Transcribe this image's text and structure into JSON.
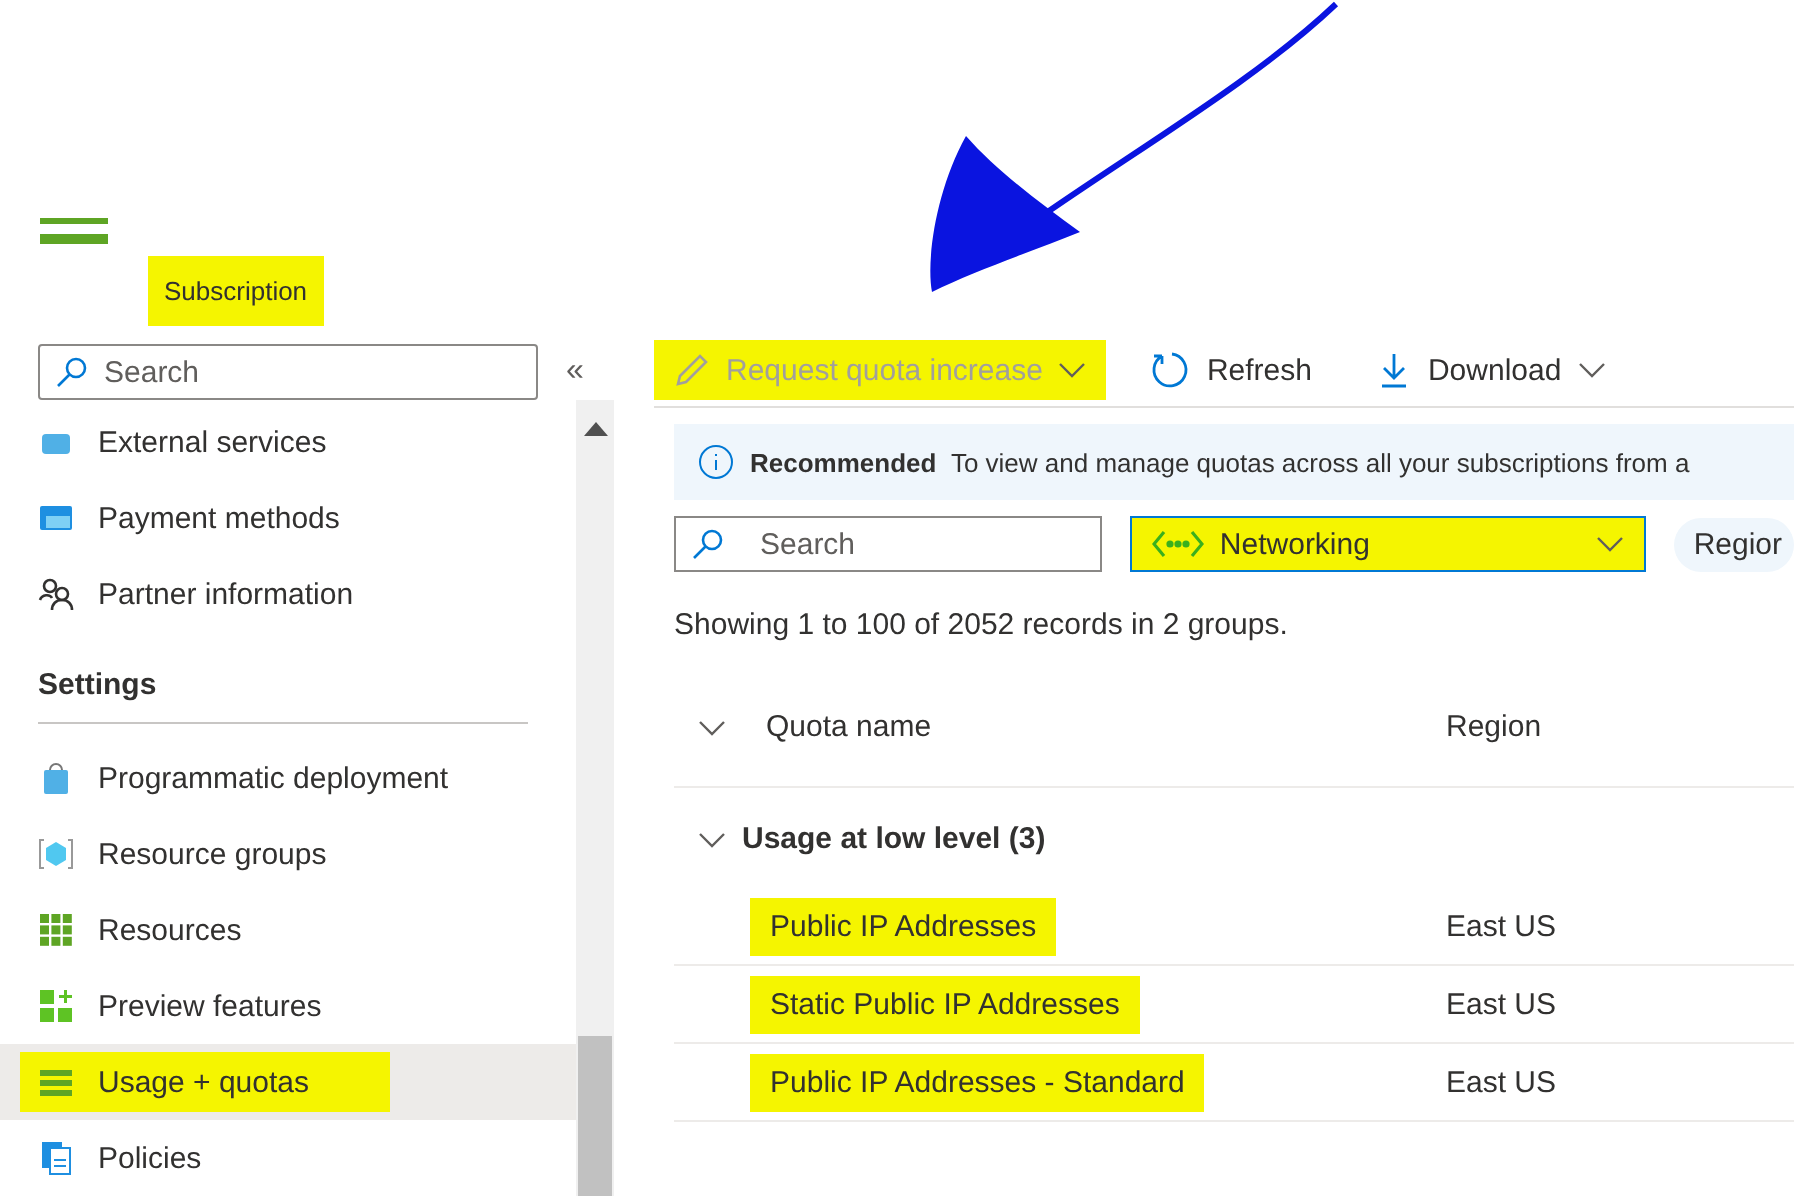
{
  "header": {
    "subtitle": "Subscription",
    "subtitle_highlighted": true
  },
  "sidebar": {
    "search": {
      "placeholder": "Search"
    },
    "collapse": "«",
    "items": [
      {
        "label": "External services",
        "selected": false,
        "highlighted": false
      },
      {
        "label": "Payment methods",
        "selected": false,
        "highlighted": false
      },
      {
        "label": "Partner information",
        "selected": false,
        "highlighted": false
      }
    ],
    "section": "Settings",
    "settings_items": [
      {
        "label": "Programmatic deployment",
        "selected": false,
        "highlighted": false
      },
      {
        "label": "Resource groups",
        "selected": false,
        "highlighted": false
      },
      {
        "label": "Resources",
        "selected": false,
        "highlighted": false
      },
      {
        "label": "Preview features",
        "selected": false,
        "highlighted": false
      },
      {
        "label": "Usage + quotas",
        "selected": true,
        "highlighted": true
      },
      {
        "label": "Policies",
        "selected": false,
        "highlighted": false
      }
    ]
  },
  "toolbar": [
    {
      "label": "Request quota increase",
      "disabled": true,
      "dropdown": true,
      "highlighted": true
    },
    {
      "label": "Refresh",
      "disabled": false,
      "dropdown": false,
      "highlighted": false
    },
    {
      "label": "Download",
      "disabled": false,
      "dropdown": true,
      "highlighted": false
    }
  ],
  "banner": {
    "title": "Recommended",
    "text": "To view and manage quotas across all your subscriptions from a"
  },
  "filters": {
    "search": {
      "placeholder": "Search"
    },
    "provider": {
      "value": "Networking",
      "highlighted": true
    },
    "region_pill": "Regior"
  },
  "summary": "Showing 1 to 100 of 2052 records in 2 groups.",
  "table": {
    "columns": [
      "Quota name",
      "Region"
    ],
    "groups": [
      {
        "label": "Usage at low level (3)",
        "expanded": true,
        "rows": [
          {
            "name": "Public IP Addresses",
            "region": "East US",
            "highlighted": true
          },
          {
            "name": "Static Public IP Addresses",
            "region": "East US",
            "highlighted": true
          },
          {
            "name": "Public IP Addresses - Standard",
            "region": "East US",
            "highlighted": true
          }
        ]
      }
    ]
  }
}
